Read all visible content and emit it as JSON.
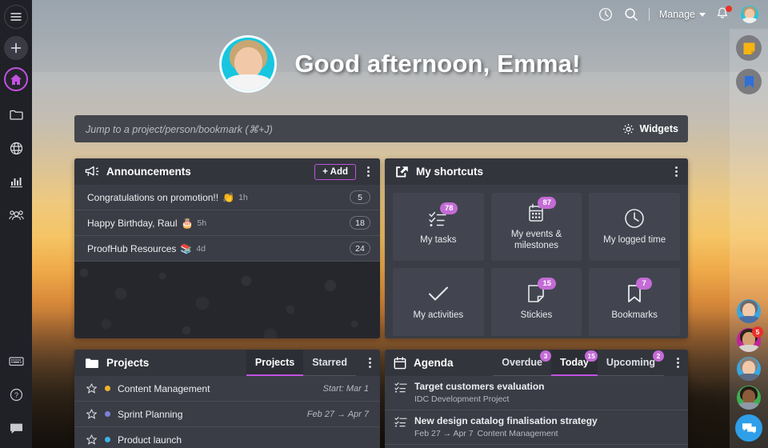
{
  "colors": {
    "accent": "#c252e0",
    "badge": "#c46bd6",
    "panel": "#3a3d46",
    "panel_head": "#33353d",
    "tile": "#42454f",
    "alert_red": "#e8332a",
    "chat_blue": "#2e9fe8"
  },
  "sidebar": {
    "top_items": [
      {
        "name": "menu-toggle",
        "icon": "hamburger-icon"
      },
      {
        "name": "create-new",
        "icon": "plus-icon"
      },
      {
        "name": "home",
        "icon": "home-icon",
        "active": true
      }
    ],
    "nav_items": [
      {
        "name": "files",
        "icon": "folder-icon"
      },
      {
        "name": "global",
        "icon": "globe-icon"
      },
      {
        "name": "reports",
        "icon": "chart-icon"
      },
      {
        "name": "people",
        "icon": "people-icon"
      }
    ],
    "bottom_items": [
      {
        "name": "keyboard-shortcuts",
        "icon": "keyboard-icon"
      },
      {
        "name": "help",
        "icon": "help-circle-icon"
      },
      {
        "name": "chat",
        "icon": "chat-bubble-icon"
      }
    ]
  },
  "topbar": {
    "clock_icon": "clock-icon",
    "search_icon": "search-icon",
    "manage_label": "Manage",
    "manage_caret_icon": "chevron-down-icon",
    "bell_icon": "bell-icon",
    "bell_has_alert": true,
    "avatar": "user-avatar"
  },
  "hero": {
    "avatar": "emma-avatar",
    "greeting": "Good afternoon, Emma!"
  },
  "jumpbar": {
    "placeholder": "Jump to a project/person/bookmark (⌘+J)",
    "value": "",
    "widgets_label": "Widgets",
    "widgets_icon": "gear-icon"
  },
  "announcements": {
    "icon": "megaphone-icon",
    "title": "Announcements",
    "add_label": "+ Add",
    "menu_icon": "kebab-menu-icon",
    "items": [
      {
        "text": "Congratulations on promotion!!",
        "emoji": "👏",
        "time": "1h",
        "count": "5"
      },
      {
        "text": "Happy Birthday, Raul",
        "emoji": "🎂",
        "time": "5h",
        "count": "18"
      },
      {
        "text": "ProofHub Resources",
        "emoji": "📚",
        "time": "4d",
        "count": "24"
      }
    ]
  },
  "shortcuts": {
    "icon": "share-box-icon",
    "title": "My shortcuts",
    "menu_icon": "kebab-menu-icon",
    "tiles": [
      {
        "label": "My tasks",
        "badge": "78",
        "icon": "checklist-icon"
      },
      {
        "label": "My events & milestones",
        "badge": "87",
        "icon": "calendar-icon"
      },
      {
        "label": "My logged time",
        "badge": "",
        "icon": "clock-icon"
      },
      {
        "label": "My activities",
        "badge": "",
        "icon": "check-icon"
      },
      {
        "label": "Stickies",
        "badge": "15",
        "icon": "sticky-note-icon"
      },
      {
        "label": "Bookmarks",
        "badge": "7",
        "icon": "bookmark-icon"
      }
    ]
  },
  "projects": {
    "icon": "folder-icon",
    "title": "Projects",
    "menu_icon": "kebab-menu-icon",
    "tabs": [
      {
        "label": "Projects",
        "active": true
      },
      {
        "label": "Starred",
        "active": false
      }
    ],
    "rows": [
      {
        "star_icon": "star-outline-icon",
        "dot": "#f0b429",
        "name": "Content Management",
        "meta": "Start: Mar 1"
      },
      {
        "star_icon": "star-outline-icon",
        "dot": "#7b82d6",
        "name": "Sprint Planning",
        "meta": "Feb 27  →  Apr 7"
      },
      {
        "star_icon": "star-outline-icon",
        "dot": "#3ab6e8",
        "name": "Product launch",
        "meta": ""
      }
    ]
  },
  "agenda": {
    "icon": "calendar-icon",
    "title": "Agenda",
    "menu_icon": "kebab-menu-icon",
    "tabs": [
      {
        "label": "Overdue",
        "badge": "3",
        "active": false
      },
      {
        "label": "Today",
        "badge": "15",
        "active": true
      },
      {
        "label": "Upcoming",
        "badge": "2",
        "active": false
      }
    ],
    "rows": [
      {
        "icon": "task-list-icon",
        "title": "Target customers evaluation",
        "dates": "",
        "dot": "#7b82d6",
        "project": "IDC Development Project"
      },
      {
        "icon": "task-list-icon",
        "title": "New design catalog finalisation strategy",
        "dates": "Feb 27  →  Apr 7",
        "dot": "#f0b429",
        "project": "Content Management"
      }
    ]
  },
  "rail": {
    "top_buttons": [
      {
        "name": "stickies",
        "icon": "sticky-note-icon",
        "color": "#f5b314"
      },
      {
        "name": "bookmarks",
        "icon": "bookmark-icon",
        "color": "#2e6fd8"
      }
    ],
    "avatars": [
      {
        "name": "contact-1",
        "badge": "",
        "ring": "#3aa6e0",
        "hair": "#6b6b6b",
        "body": "#4a6fa5"
      },
      {
        "name": "contact-2",
        "badge": "5",
        "ring": "#c0249c",
        "hair": "#2c2119",
        "body": "#d8d2cc"
      },
      {
        "name": "contact-3",
        "badge": "",
        "ring": "#3aa6e0",
        "hair": "#8a7f76",
        "body": "#5a6b82"
      },
      {
        "name": "contact-4",
        "badge": "",
        "ring": "#3fae53",
        "hair": "#241a14",
        "body": "#8e9aa6"
      }
    ],
    "chat_icon": "chat-bubbles-icon"
  }
}
